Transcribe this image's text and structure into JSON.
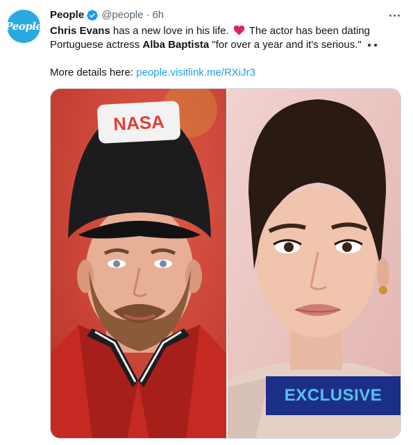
{
  "tweet": {
    "author_name": "People",
    "handle": "@people",
    "separator": "·",
    "time": "6h",
    "avatar_text": "People",
    "text": {
      "line1_name": "Chris Evans",
      "line1_rest": " has a new love in his life.",
      "line1_after_heart": " The actor has been dating",
      "line2_start": "Portuguese actress ",
      "line2_name": "Alba Baptista",
      "line2_rest": " \"for over a year and it's serious.\"",
      "details_label": "More details here: ",
      "link": "people.visitlink.me/RXiJr3"
    },
    "media": {
      "badge_text": "EXCLUSIVE",
      "left_photo": "chris-evans-photo",
      "right_photo": "alba-baptista-photo"
    }
  },
  "colors": {
    "accent": "#1d9bf0",
    "brand_avatar": "#2aa9e0",
    "badge_bg": "#1c2f88",
    "badge_text": "#56c1ee",
    "heart": "#f91880"
  }
}
